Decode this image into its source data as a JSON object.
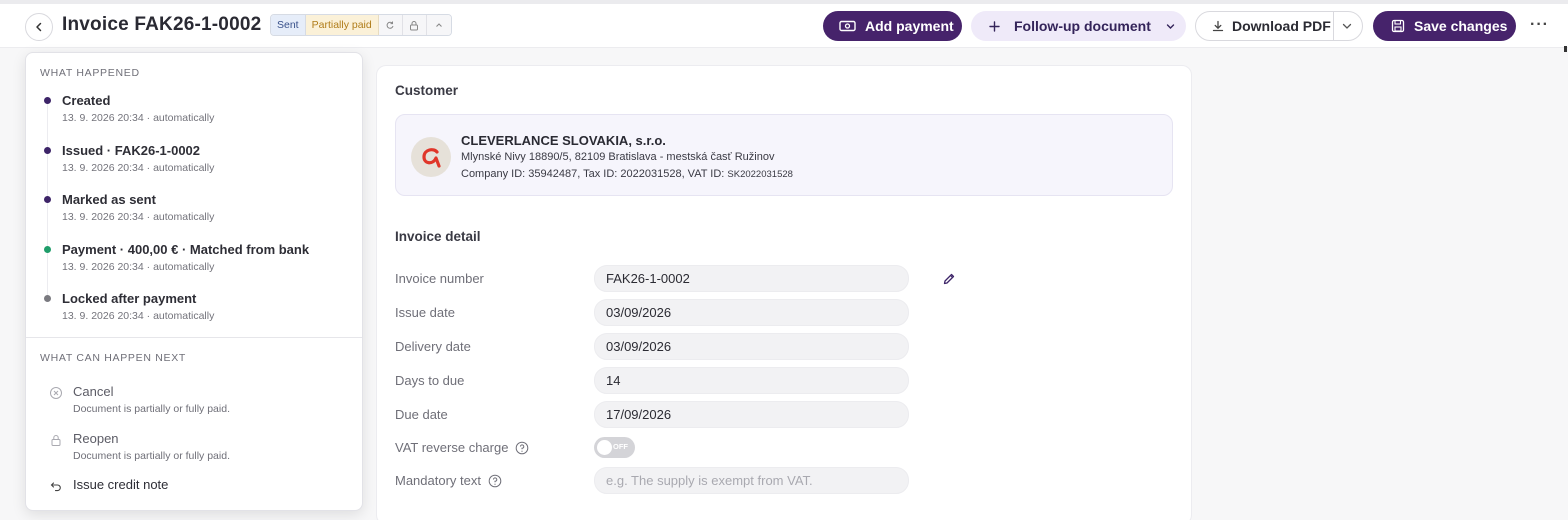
{
  "header": {
    "title": "Invoice FAK26-1-0002",
    "badge_sent": "Sent",
    "badge_paid": "Partially paid",
    "add_payment": "Add payment",
    "follow_up": "Follow-up document",
    "download_pdf": "Download PDF",
    "save_changes": "Save changes",
    "more": "···"
  },
  "history": {
    "happened_label": "WHAT HAPPENED",
    "events": [
      {
        "title": "Created",
        "sub": "13. 9. 2026 20:34 · automatically",
        "color": "#3d2468"
      },
      {
        "title": "Issued · FAK26-1-0002",
        "sub": "13. 9. 2026 20:34 · automatically",
        "color": "#3d2468"
      },
      {
        "title": "Marked as sent",
        "sub": "13. 9. 2026 20:34 · automatically",
        "color": "#3d2468"
      },
      {
        "title": "Payment · 400,00 € · Matched from bank",
        "sub": "13. 9. 2026 20:34 · automatically",
        "color": "#1f9d6a"
      },
      {
        "title": "Locked after payment",
        "sub": "13. 9. 2026 20:34 · automatically",
        "color": "#7a7a80"
      }
    ],
    "next_label": "WHAT CAN HAPPEN NEXT",
    "actions": [
      {
        "title": "Cancel",
        "sub": "Document is partially or fully paid."
      },
      {
        "title": "Reopen",
        "sub": "Document is partially or fully paid."
      },
      {
        "title": "Issue credit note",
        "sub": ""
      }
    ]
  },
  "customer": {
    "heading": "Customer",
    "name": "CLEVERLANCE SLOVAKIA, s.r.o.",
    "address": "Mlynské Nivy 18890/5, 82109 Bratislava - mestská časť Ružinov",
    "ids": "Company ID: 35942487, Tax ID: 2022031528, VAT ID: ",
    "vat_id": "SK2022031528"
  },
  "detail": {
    "heading": "Invoice detail",
    "invoice_number_label": "Invoice number",
    "invoice_number": "FAK26-1-0002",
    "issue_date_label": "Issue date",
    "issue_date": "03/09/2026",
    "delivery_date_label": "Delivery date",
    "delivery_date": "03/09/2026",
    "days_due_label": "Days to due",
    "days_due": "14",
    "due_date_label": "Due date",
    "due_date": "17/09/2026",
    "vat_reverse_label": "VAT reverse charge",
    "vat_reverse_toggle": "OFF",
    "mandatory_label": "Mandatory text",
    "mandatory_placeholder": "e.g. The supply is exempt from VAT."
  },
  "icons": {
    "back": "chevron-left-icon",
    "add_payment": "cash-icon",
    "follow_up": "plus-icon",
    "download": "download-icon",
    "save": "floppy-disk-icon",
    "edit": "pencil-icon",
    "cancel": "x-circle-icon",
    "reopen": "lock-icon",
    "credit_note": "undo-arrow-icon"
  },
  "colors": {
    "primary": "#46236b",
    "follow_up_bg": "#efeaf9",
    "badge_sent_bg": "#e6edf9",
    "badge_paid_bg": "#fbf1d8",
    "customer_box_bg": "#f6f5fc",
    "payment_dot": "#1f9d6a"
  }
}
